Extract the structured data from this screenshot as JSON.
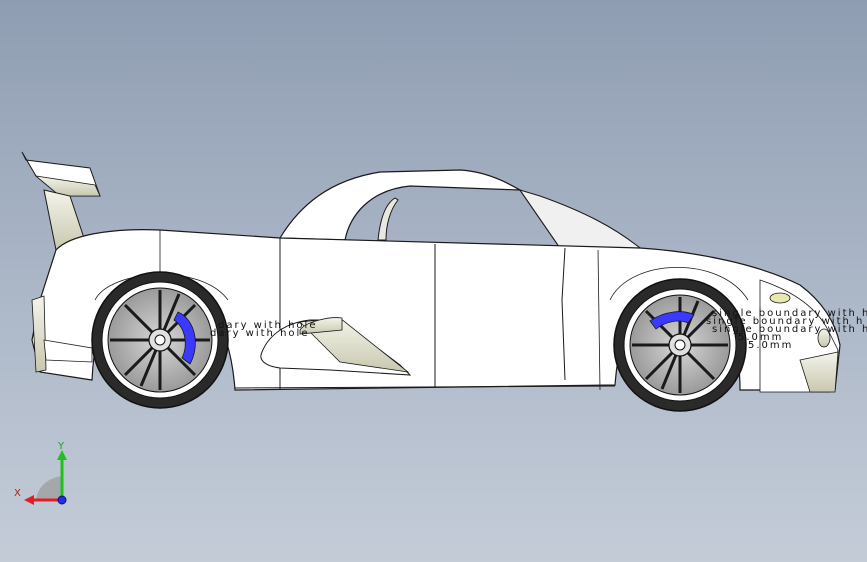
{
  "viewport": {
    "background_top": "#8f9db2",
    "background_bottom": "#c4ccd8"
  },
  "model": {
    "description_name": "sports-car-side-view",
    "body_color": "#ffffff",
    "line_color": "#1a1a1a",
    "brake_color": "#3a3aff"
  },
  "annotations": {
    "rear_1": "dary with hole",
    "rear_2": "dary with hole",
    "front_1": "single boundary with h",
    "front_2": "single boundary with h",
    "front_3": "single boundary with h",
    "front_4": "5.0mm",
    "front_5": "5.0mm"
  },
  "triad": {
    "x_label": "X",
    "y_label": "Y",
    "x_color": "#e02020",
    "y_color": "#20c020",
    "z_color": "#2030e0"
  }
}
